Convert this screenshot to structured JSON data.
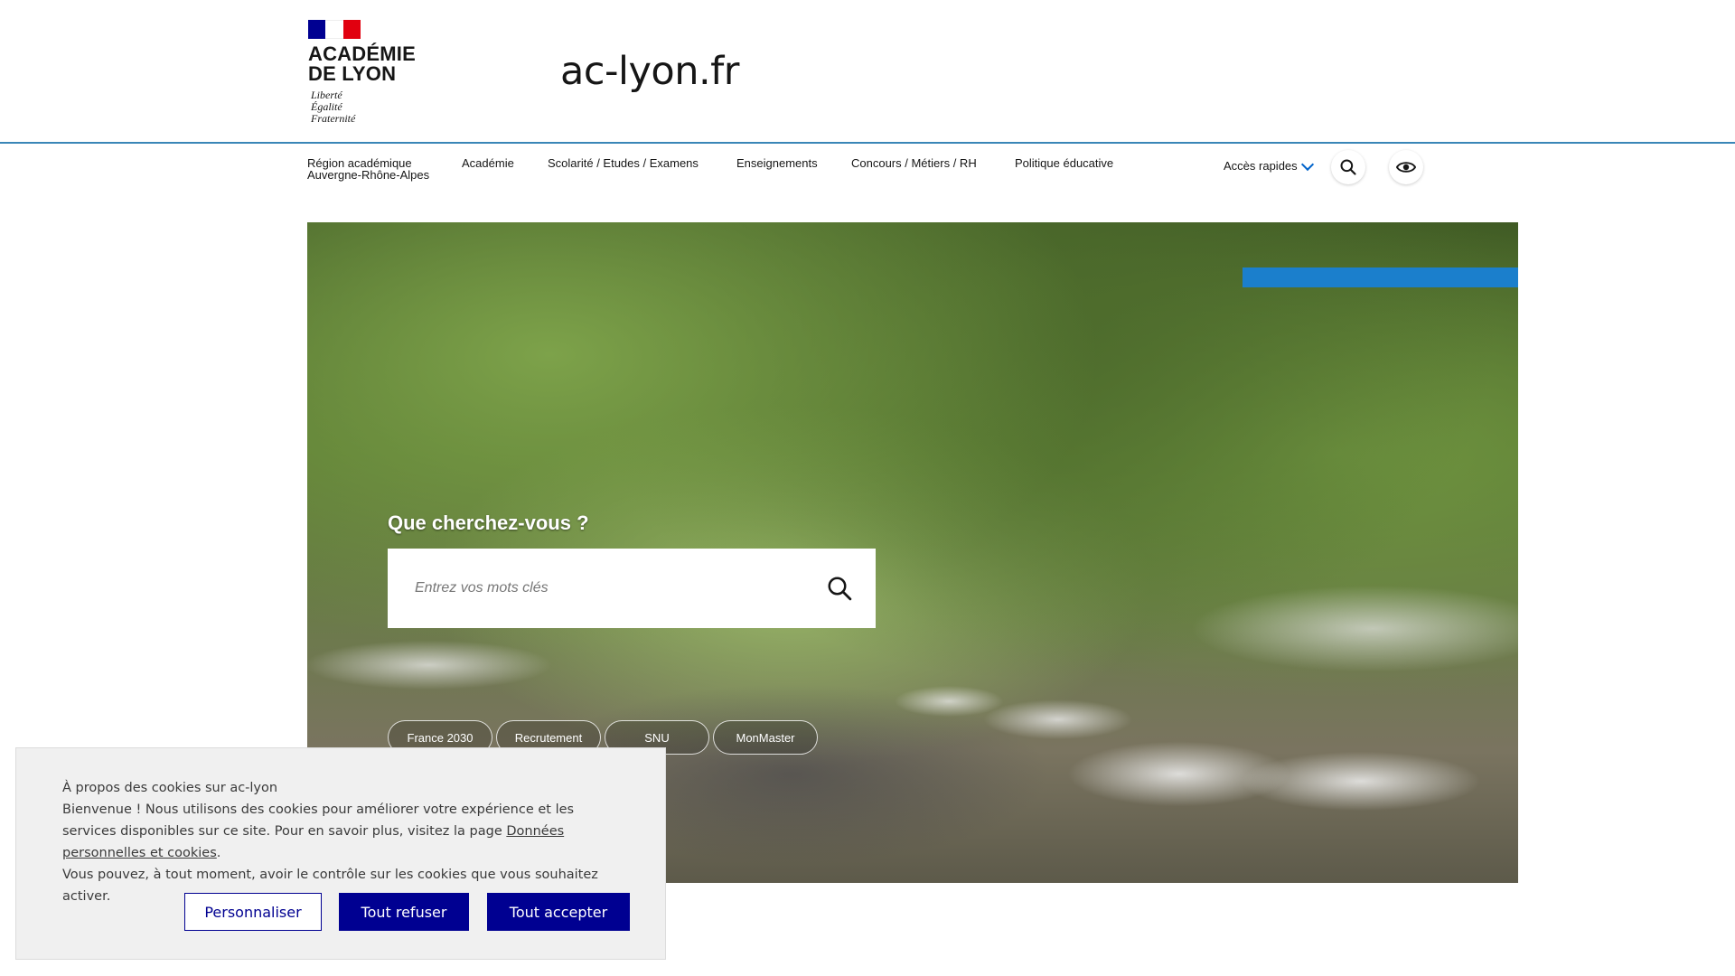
{
  "header": {
    "academie_line1": "ACADÉMIE",
    "academie_line2": "DE LYON",
    "motto": [
      "Liberté",
      "Égalité",
      "Fraternité"
    ],
    "site_title": "ac-lyon.fr"
  },
  "nav": {
    "items": [
      {
        "line1": "Région académique",
        "line2": "Auvergne-Rhône-Alpes"
      },
      {
        "line1": "Académie",
        "line2": ""
      },
      {
        "line1": "Scolarité / Etudes / Examens",
        "line2": ""
      },
      {
        "line1": "Enseignements",
        "line2": ""
      },
      {
        "line1": "Concours / Métiers / RH",
        "line2": ""
      },
      {
        "line1": "Politique éducative",
        "line2": ""
      }
    ],
    "quick_access": "Accès rapides",
    "search_icon": "search-icon",
    "accessibility_icon": "eye-icon"
  },
  "hero": {
    "heading": "Que cherchez-vous ?",
    "search_placeholder": "Entrez vos mots clés",
    "tags": [
      "France 2030",
      "Recrutement",
      "SNU",
      "MonMaster"
    ],
    "accent_color": "#1b7fcc"
  },
  "cookie_banner": {
    "title": "À propos des cookies sur ac-lyon",
    "body_part1": "Bienvenue ! Nous utilisons des cookies pour améliorer votre expérience et les services disponibles sur ce site. Pour en savoir plus, visitez la page ",
    "link": "Données personnelles et cookies",
    "body_part2": ".",
    "body_line3": "Vous pouvez, à tout moment, avoir le contrôle sur les cookies que vous souhaitez activer.",
    "btn_customize": "Personnaliser",
    "btn_refuse": "Tout refuser",
    "btn_accept": "Tout accepter",
    "button_color": "#000091"
  }
}
